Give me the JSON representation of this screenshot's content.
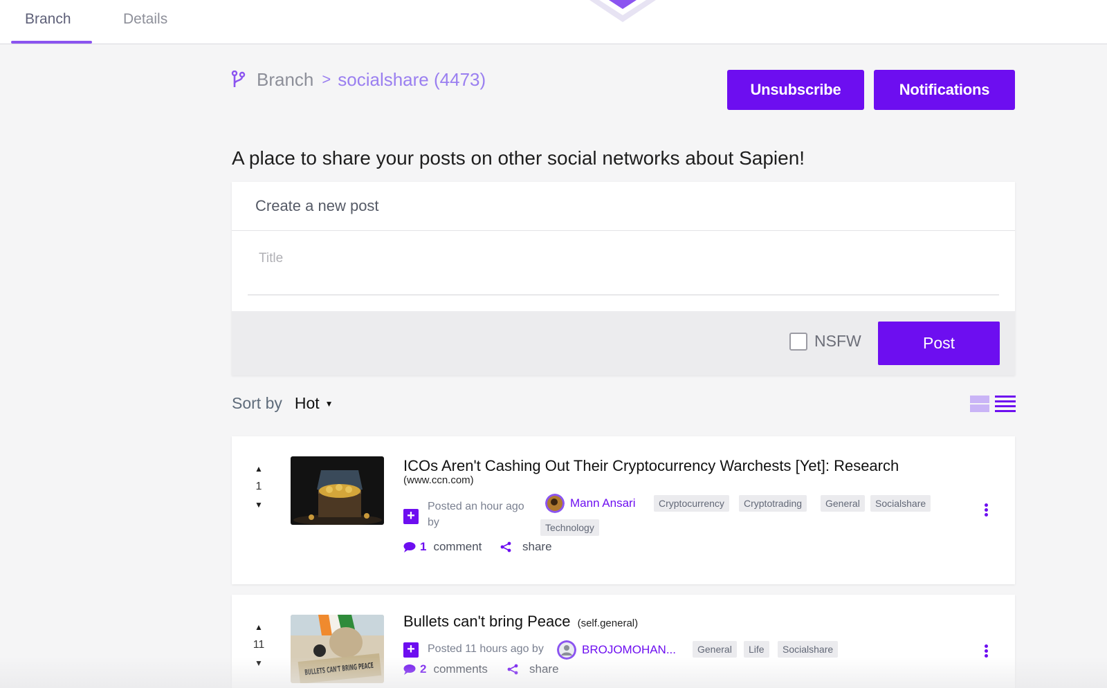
{
  "tabs": [
    {
      "label": "Branch",
      "active": true
    },
    {
      "label": "Details",
      "active": false
    }
  ],
  "breadcrumb": {
    "home": "Branch",
    "separator": ">",
    "current": "socialshare (4473)"
  },
  "header_buttons": {
    "unsubscribe": "Unsubscribe",
    "notifications": "Notifications"
  },
  "description": "A place to share your posts on other social networks about Sapien!",
  "composer": {
    "heading": "Create a new post",
    "title_placeholder": "Title",
    "nsfw_label": "NSFW",
    "nsfw_checked": false,
    "post_label": "Post"
  },
  "sort": {
    "label": "Sort by",
    "value": "Hot"
  },
  "posts": [
    {
      "score": "1",
      "title": "ICOs Aren't Cashing Out Their Cryptocurrency Warchests [Yet]: Research",
      "domain": "(www.ccn.com)",
      "posted": "Posted an hour ago",
      "by": "by",
      "author": "Mann Ansari",
      "tags": [
        "Cryptocurrency",
        "Cryptotrading",
        "General",
        "Socialshare",
        "Technology"
      ],
      "comment_count": "1",
      "comment_label": "comment",
      "share_label": "share"
    },
    {
      "score": "11",
      "title": "Bullets can't bring Peace",
      "domain": "(self.general)",
      "posted": "Posted 11 hours ago by",
      "author": "BROJOMOHAN...",
      "tags": [
        "General",
        "Life",
        "Socialshare"
      ],
      "comment_count": "2",
      "comment_label": "comments",
      "share_label": "share",
      "thumb_text": "BULLETS CAN'T BRING PEACE"
    }
  ],
  "colors": {
    "accent": "#6d0ef0",
    "accent_light": "#9a7ff0",
    "background": "#f5f5f6"
  }
}
